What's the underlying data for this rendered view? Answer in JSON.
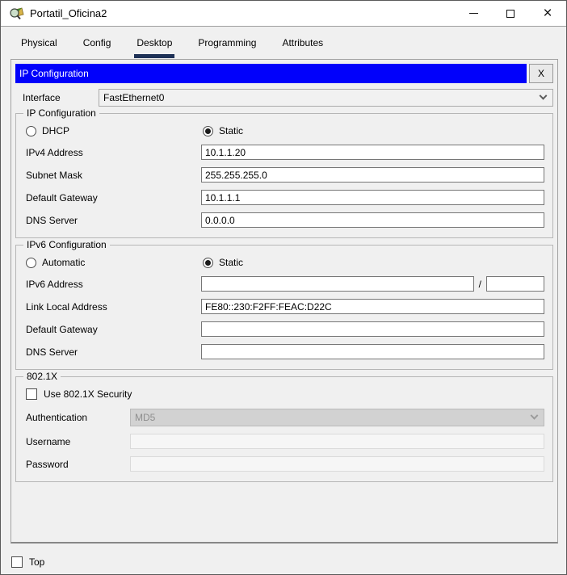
{
  "window": {
    "title": "Portatil_Oficina2",
    "icons": {
      "app": "packet-tracer-app-icon",
      "minimize": "minimize-icon",
      "maximize": "maximize-icon",
      "close": "close-icon"
    }
  },
  "tabs": {
    "items": [
      {
        "label": "Physical",
        "active": false
      },
      {
        "label": "Config",
        "active": false
      },
      {
        "label": "Desktop",
        "active": true
      },
      {
        "label": "Programming",
        "active": false
      },
      {
        "label": "Attributes",
        "active": false
      }
    ]
  },
  "dialog": {
    "title": "IP Configuration",
    "close_label": "X",
    "interface": {
      "label": "Interface",
      "value": "FastEthernet0"
    }
  },
  "ip_config": {
    "group_title": "IP Configuration",
    "dhcp_label": "DHCP",
    "static_label": "Static",
    "selected": "Static",
    "fields": [
      {
        "label": "IPv4 Address",
        "value": "10.1.1.20"
      },
      {
        "label": "Subnet Mask",
        "value": "255.255.255.0"
      },
      {
        "label": "Default Gateway",
        "value": "10.1.1.1"
      },
      {
        "label": "DNS Server",
        "value": "0.0.0.0"
      }
    ]
  },
  "ipv6_config": {
    "group_title": "IPv6 Configuration",
    "automatic_label": "Automatic",
    "static_label": "Static",
    "selected": "Static",
    "ipv6_address": {
      "label": "IPv6 Address",
      "value": "",
      "separator": "/",
      "prefix": ""
    },
    "fields": [
      {
        "label": "Link Local Address",
        "value": "FE80::230:F2FF:FEAC:D22C"
      },
      {
        "label": "Default Gateway",
        "value": ""
      },
      {
        "label": "DNS Server",
        "value": ""
      }
    ]
  },
  "dot1x": {
    "group_title": "802.1X",
    "checkbox_label": "Use 802.1X Security",
    "checked": false,
    "authentication": {
      "label": "Authentication",
      "value": "MD5",
      "disabled": true
    },
    "username": {
      "label": "Username",
      "value": "",
      "disabled": true
    },
    "password": {
      "label": "Password",
      "value": "",
      "disabled": true
    }
  },
  "footer": {
    "top_label": "Top",
    "checked": false
  },
  "colors": {
    "header_blue": "#0101fb",
    "tab_underline": "#1e3156",
    "panel_bg": "#f0f0f0",
    "disabled_bg": "#d2d2d2"
  }
}
